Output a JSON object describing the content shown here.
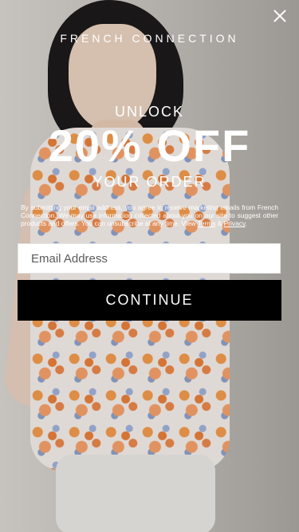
{
  "modal": {
    "brand": "FRENCH CONNECTION",
    "unlock": "UNLOCK",
    "headline": "20% OFF",
    "subheadline": "YOUR ORDER",
    "legal_text": "By submitting your email address, you agree to receive marketing emails from French Connection. We may use information collected about you on our site to suggest other products and offers. You can unsubscribe at any time. View",
    "terms_link": "Terms",
    "amp": "&",
    "privacy_link": "Privacy",
    "period": ".",
    "email_placeholder": "Email Address",
    "continue_label": "CONTINUE",
    "close_icon": "close-icon"
  },
  "colors": {
    "button_bg": "#000000",
    "text_on_image": "#ffffff"
  }
}
